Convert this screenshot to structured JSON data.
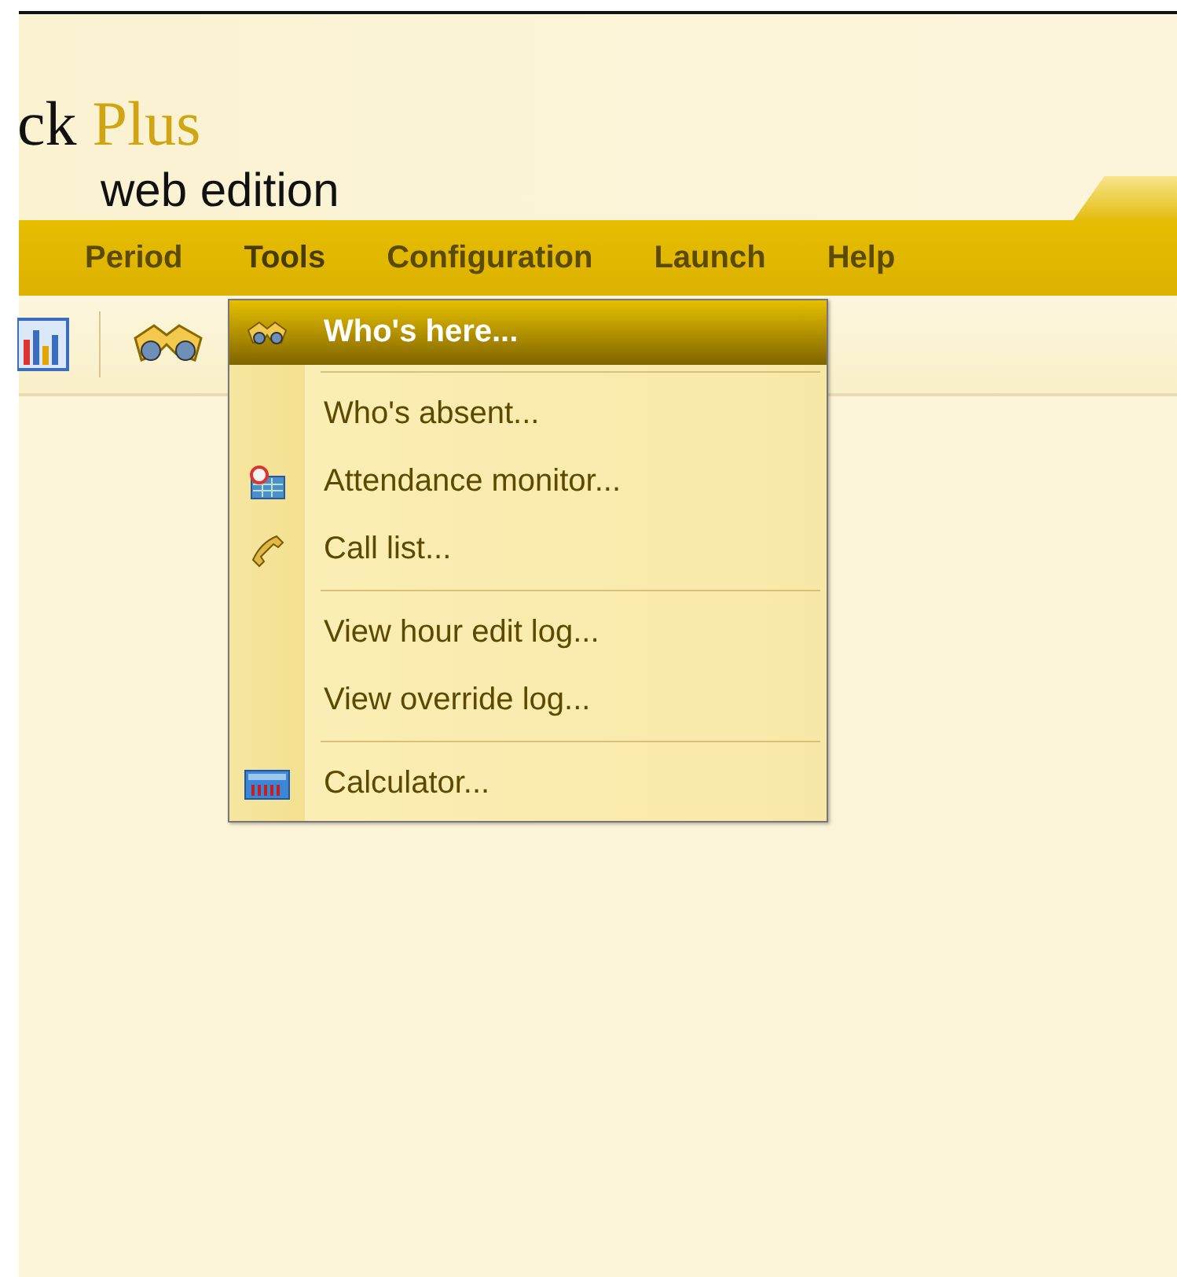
{
  "header": {
    "title": "ck",
    "title_accent": "Plus",
    "subtitle": "web edition"
  },
  "menubar": [
    {
      "label": "Period",
      "open": false
    },
    {
      "label": "Tools",
      "open": true
    },
    {
      "label": "Configuration",
      "open": false
    },
    {
      "label": "Launch",
      "open": false
    },
    {
      "label": "Help",
      "open": false
    }
  ],
  "dropdown": [
    {
      "kind": "binoculars",
      "label": "Who's here...",
      "selected": true
    },
    {
      "kind": "separator"
    },
    {
      "kind": "plain",
      "label": "Who's absent...",
      "selected": false
    },
    {
      "kind": "monitor",
      "label": "Attendance monitor...",
      "selected": false
    },
    {
      "kind": "phone",
      "label": "Call list...",
      "selected": false
    },
    {
      "kind": "separator"
    },
    {
      "kind": "plain",
      "label": "View hour edit log...",
      "selected": false
    },
    {
      "kind": "plain",
      "label": "View override log...",
      "selected": false
    },
    {
      "kind": "separator"
    },
    {
      "kind": "calculator",
      "label": "Calculator...",
      "selected": false
    }
  ]
}
